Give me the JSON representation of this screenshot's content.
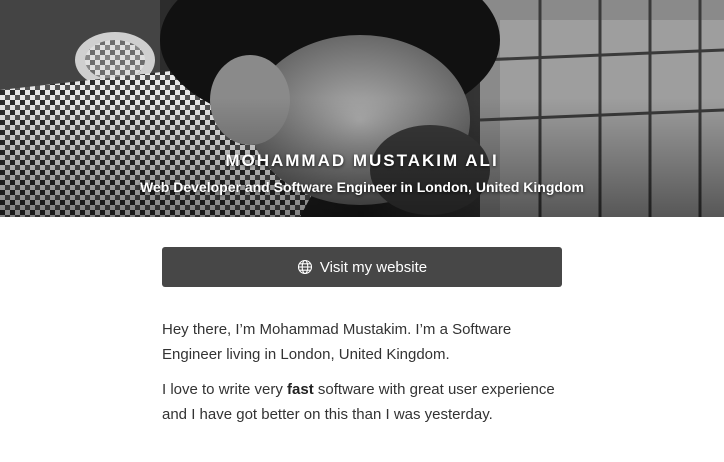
{
  "profile": {
    "name": "MOHAMMAD MUSTAKIM ALI",
    "tagline": "Web Developer and Software Engineer in London, United Kingdom"
  },
  "website_button": {
    "label": "Visit my website",
    "icon": "globe-icon"
  },
  "bio": {
    "paragraph1": "Hey there, I’m Mohammad Mustakim. I’m a Software Engineer living in London, United Kingdom.",
    "paragraph2_before": "I love to write very ",
    "paragraph2_bold": "fast",
    "paragraph2_after": " software with great user experience and I have got better on this than I was yesterday."
  },
  "colors": {
    "button_bg": "#474747",
    "text": "#333333"
  }
}
